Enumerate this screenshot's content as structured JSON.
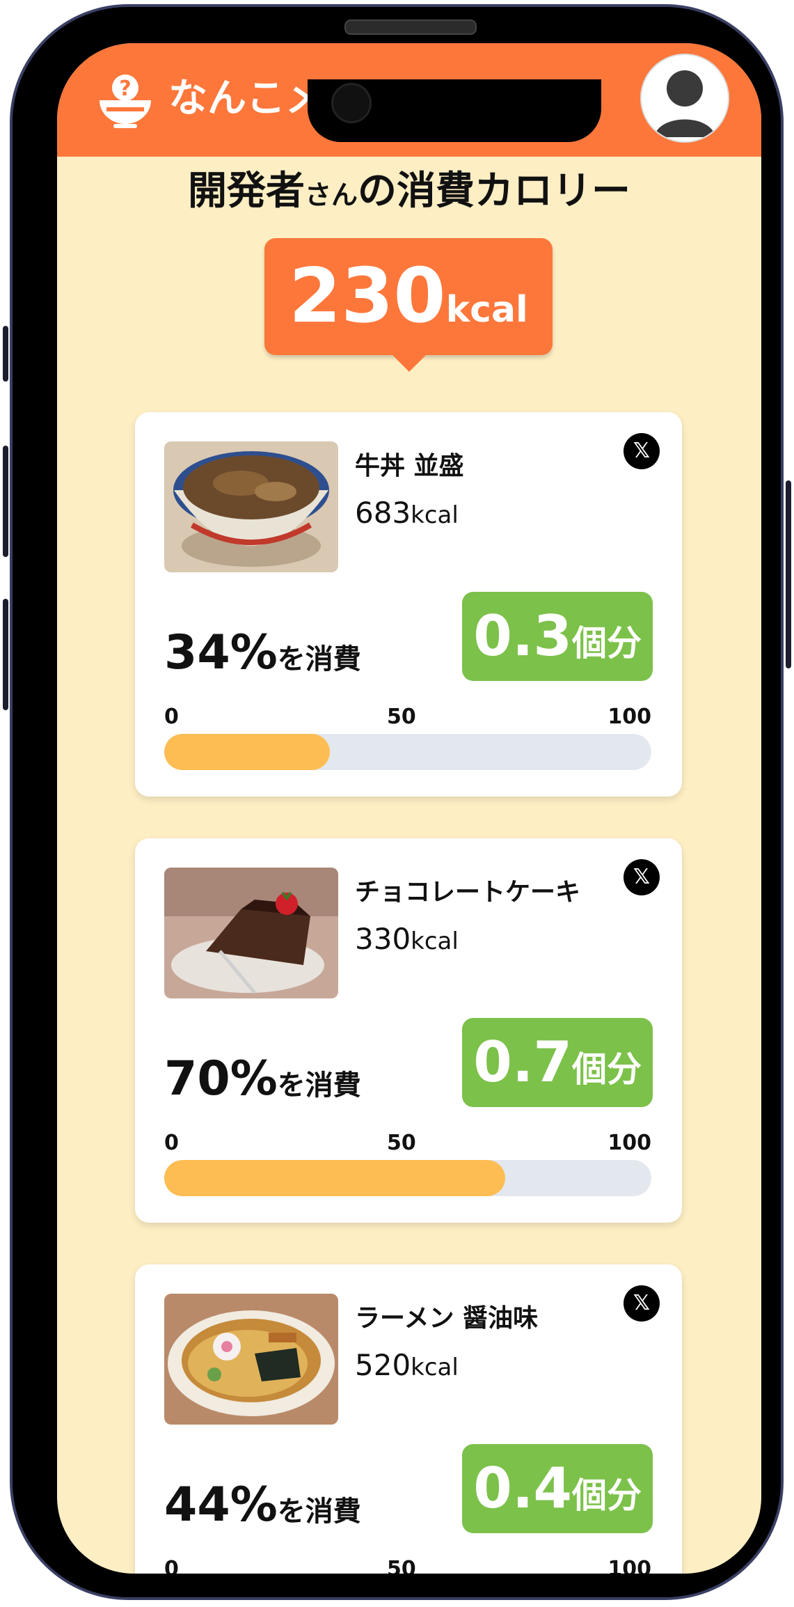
{
  "app": {
    "name": "なんこメシ"
  },
  "title": {
    "user": "開発者",
    "honorific": "さん",
    "rest": "の消費カロリー"
  },
  "total": {
    "value": "230",
    "unit": "kcal"
  },
  "unit_kcal": "kcal",
  "consumed_suffix": "を消費",
  "portion_suffix": "個分",
  "share_icon": "x-logo-icon",
  "scale": {
    "min": "0",
    "mid": "50",
    "max": "100"
  },
  "foods": [
    {
      "name": "牛丼 並盛",
      "kcal": "683",
      "percent_label": "34%",
      "portion": "0.3",
      "progress": 34
    },
    {
      "name": "チョコレートケーキ",
      "kcal": "330",
      "percent_label": "70%",
      "portion": "0.7",
      "progress": 70
    },
    {
      "name": "ラーメン 醤油味",
      "kcal": "520",
      "percent_label": "44%",
      "portion": "0.4",
      "progress": 44
    }
  ],
  "colors": {
    "header": "#fd773b",
    "background": "#feeec4",
    "badge": "#7cc14a",
    "progress_fill": "#fdbd53",
    "progress_track": "#e3e8ef"
  }
}
